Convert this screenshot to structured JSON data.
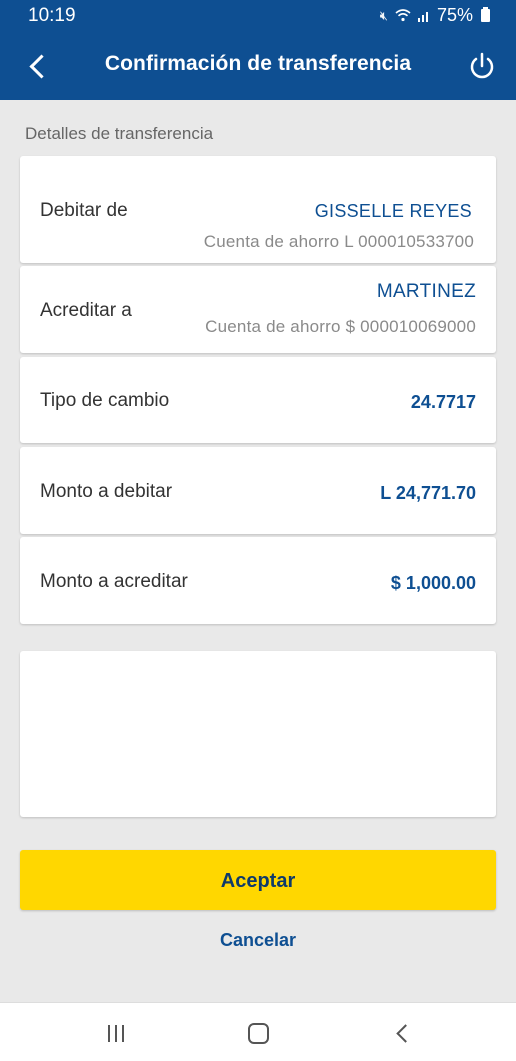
{
  "status_bar": {
    "time": "10:19",
    "battery": "75%",
    "icons": [
      "mute-icon",
      "wifi-icon",
      "signal-icon",
      "battery-icon"
    ]
  },
  "header": {
    "title": "Confirmación de transferencia"
  },
  "section": {
    "title": "Detalles de transferencia"
  },
  "debit": {
    "label": "Debitar de",
    "name": "GISSELLE  REYES",
    "account": "Cuenta de ahorro  L  000010533700"
  },
  "credit": {
    "label": "Acreditar a",
    "name": "MARTINEZ",
    "account": "Cuenta de ahorro $  000010069000"
  },
  "exchange_rate": {
    "label": "Tipo de cambio",
    "value": "24.7717"
  },
  "debit_amount": {
    "label": "Monto a debitar",
    "value": "L 24,771.70"
  },
  "credit_amount": {
    "label": "Monto a acreditar",
    "value": "$ 1,000.00"
  },
  "actions": {
    "accept": "Aceptar",
    "cancel": "Cancelar"
  },
  "colors": {
    "primary": "#0e4f92",
    "accent": "#ffd700",
    "background": "#e9e9e9"
  }
}
